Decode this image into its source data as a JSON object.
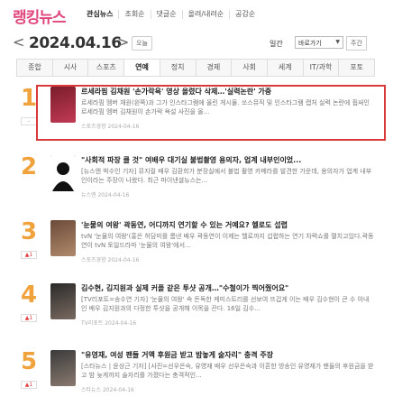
{
  "brand": "랭킹뉴스",
  "sort_tabs": [
    "관심뉴스",
    "조회순",
    "댓글순",
    "올려/내려순",
    "공감순"
  ],
  "date": {
    "prev": "<",
    "value": "2024.04.16",
    "next": ">",
    "today_label": "오늘"
  },
  "period": {
    "label": "일간",
    "selected": "바로가기",
    "weekly_label": "주간"
  },
  "categories": [
    {
      "label": "종합",
      "active": false
    },
    {
      "label": "시사",
      "active": false
    },
    {
      "label": "스포츠",
      "active": false
    },
    {
      "label": "연예",
      "active": true
    },
    {
      "label": "정치",
      "active": false
    },
    {
      "label": "경제",
      "active": false
    },
    {
      "label": "사회",
      "active": false
    },
    {
      "label": "세계",
      "active": false
    },
    {
      "label": "IT/과학",
      "active": false
    },
    {
      "label": "포토",
      "active": false
    }
  ],
  "items": [
    {
      "rank": "1",
      "change": "-",
      "title": "르세라핌 김채원 '손가락욕' 영상 올렸다 삭제…'실력논란' 가중",
      "summary": "르세라핌 멤버 채원(왼쪽)과 그가 인스타그램에 올린 게시물. 쏘스뮤직 및 인스타그램 캡처 실력 논란에 휩싸인 르세라핌 멤버 김채원이 손가락 욕설 사진을 올...",
      "source": "스포츠경향 2024-04-16",
      "thumb_colors": [
        "#7a1d2b",
        "#c23a55"
      ]
    },
    {
      "rank": "2",
      "change": "",
      "title": "\"사회적 파장 클 것\" 여배우 대기실 불법촬영 용의자, 업계 내부인이었...",
      "summary": "[뉴스엔 박수인 기자] 뮤지컬 배우 김환희가 분장실에서 불법 촬영 카메라를 발견한 가운데, 용의자가 업계 내부인이라는 주장이 나왔다. 최근 파이낸셜뉴스는...",
      "source": "뉴스엔 2024-04-16",
      "thumb_colors": [
        "#111111",
        "#333333"
      ]
    },
    {
      "rank": "3",
      "change": "▲1",
      "title": "'눈물의 여왕' 곽동연, 어디까지 연기할 수 있는 거예요? 헬로도 섭렵",
      "summary": "tvN '눈물의 여왕'(홍은 허담미를 롬낸 배우 곽동연이 이제는 헬로까지 섭렵하는 연기 차력쇼를 펼치고있다.곽동연이 tvN 토일드라마 '눈물의 여왕'에서...",
      "source": "스포츠경향 2024-04-16",
      "thumb_colors": [
        "#6b4a3a",
        "#b08a6a"
      ]
    },
    {
      "rank": "4",
      "change": "▲1",
      "title": "김수현, 김지원과 실제 커플 같은 투샷 공개…\"수철이가 찍어줬어요\"",
      "summary": "[TV리포트=송수연 기자] '눈물의 여왕' 속 돈독한 케미스트리를 선보여 뜨겁게 이는 배우 김수현이 큰 수 아내인 배우 김지원과의 다정한 투샷을 공개해 이목을 끈다. 16일 김수...",
      "source": "TV리포트 2024-04-16",
      "thumb_colors": [
        "#2a2a2a",
        "#7a6a60"
      ]
    },
    {
      "rank": "5",
      "change": "▲1",
      "title": "\"유영재, 여성 팬들 거액 후원금 받고 밤놓게 술자리\" 충격 주장",
      "summary": "[스타뉴스 | 윤상근 기자] [사진=선우은숙, 유영재 배우 선우은숙과 이혼한 방송인 유영재가 팬들의 후원금을 받고 밤 늦게까지 술자리를 가졌다는 충격적인...",
      "source": "스타뉴스 2024-04-16",
      "thumb_colors": [
        "#3a3a3a",
        "#8a7a70"
      ]
    }
  ]
}
